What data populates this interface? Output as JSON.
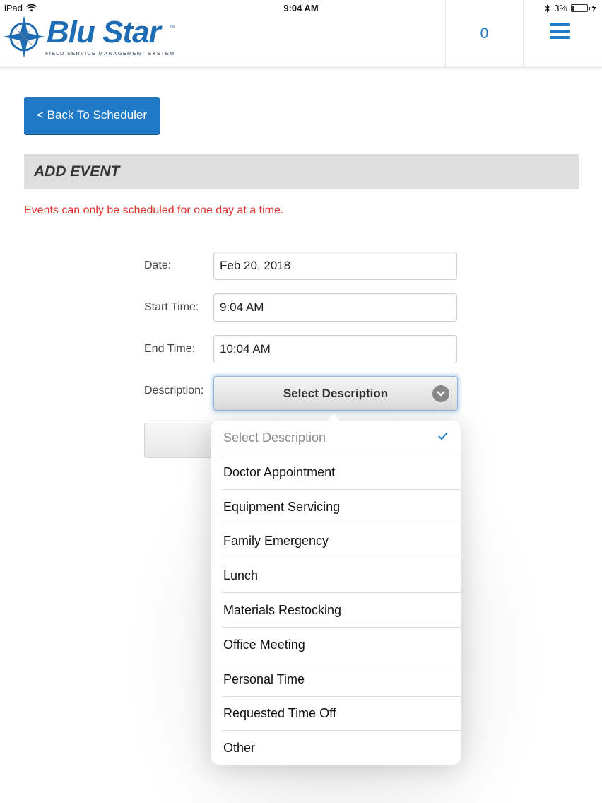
{
  "status_bar": {
    "device": "iPad",
    "time": "9:04 AM",
    "battery": "3%"
  },
  "header": {
    "logo_name": "BluStar",
    "logo_text": "Blu Star",
    "logo_tm": "™",
    "logo_subtitle": "FIELD SERVICE MANAGEMENT SYSTEM",
    "notification_count": "0",
    "menu_icon": "hamburger-icon"
  },
  "back_button": {
    "label": "< Back To Scheduler"
  },
  "section": {
    "title": "ADD EVENT"
  },
  "warning": "Events can only be scheduled for one day at a time.",
  "form": {
    "date_label": "Date:",
    "date_value": "Feb 20, 2018",
    "start_label": "Start Time:",
    "start_value": "9:04 AM",
    "end_label": "End Time:",
    "end_value": "10:04 AM",
    "description_label": "Description:",
    "description_value": "Select Description"
  },
  "dropdown": {
    "selected_index": 0,
    "options": [
      "Select Description",
      "Doctor Appointment",
      "Equipment Servicing",
      "Family Emergency",
      "Lunch",
      "Materials Restocking",
      "Office Meeting",
      "Personal Time",
      "Requested Time Off",
      "Other"
    ]
  },
  "colors": {
    "accent": "#1f79c6",
    "warning": "#e0302b",
    "section_bg": "#dedede",
    "check": "#1f7bc8"
  }
}
